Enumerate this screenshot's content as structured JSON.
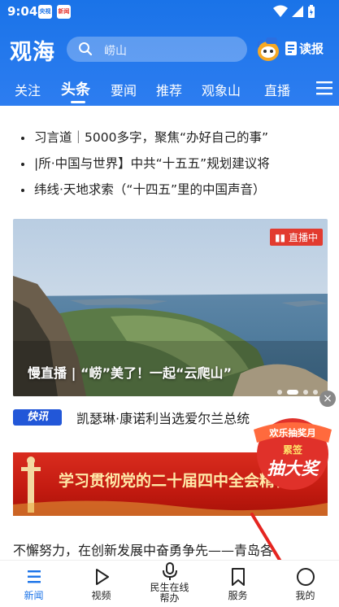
{
  "status": {
    "time": "9:04",
    "mini_app_1": "央视",
    "mini_app_2": "新闻"
  },
  "header": {
    "logo": "观海",
    "search_placeholder": "崂山",
    "read_label": "读报",
    "tabs": [
      "关注",
      "头条",
      "要闻",
      "推荐",
      "观象山",
      "直播"
    ],
    "active_tab": "头条"
  },
  "top_news": [
    "习言道｜5000多字，聚焦“办好自己的事”",
    "|所·中国与世界】中共“十五五”规划建议将",
    "纬线·天地求索（“十四五”里的中国声音）"
  ],
  "live_card": {
    "badge": "直播中",
    "title": "慢直播 | “崂”美了！一起“云爬山”"
  },
  "flash": {
    "tag": "快讯",
    "text": "凯瑟琳·康诺利当选爱尔兰总统"
  },
  "promo": {
    "line1": "欢乐抽奖月",
    "line2": "累签",
    "line3": "抽大奖"
  },
  "banner": {
    "text": "学习贯彻党的二十届四中全会精神"
  },
  "bottom_news": "不懈努力，在创新发展中奋勇争先——青岛各",
  "bottom_nav": [
    {
      "label": "新闻",
      "active": true
    },
    {
      "label": "视频",
      "active": false
    },
    {
      "label": "民生在线帮办",
      "active": false
    },
    {
      "label": "服务",
      "active": false
    },
    {
      "label": "我的",
      "active": false
    }
  ],
  "colors": {
    "brand": "#1a73e8",
    "live_red": "#e23b2f",
    "banner_red": "#c21a10",
    "flash_blue": "#2257d8"
  }
}
